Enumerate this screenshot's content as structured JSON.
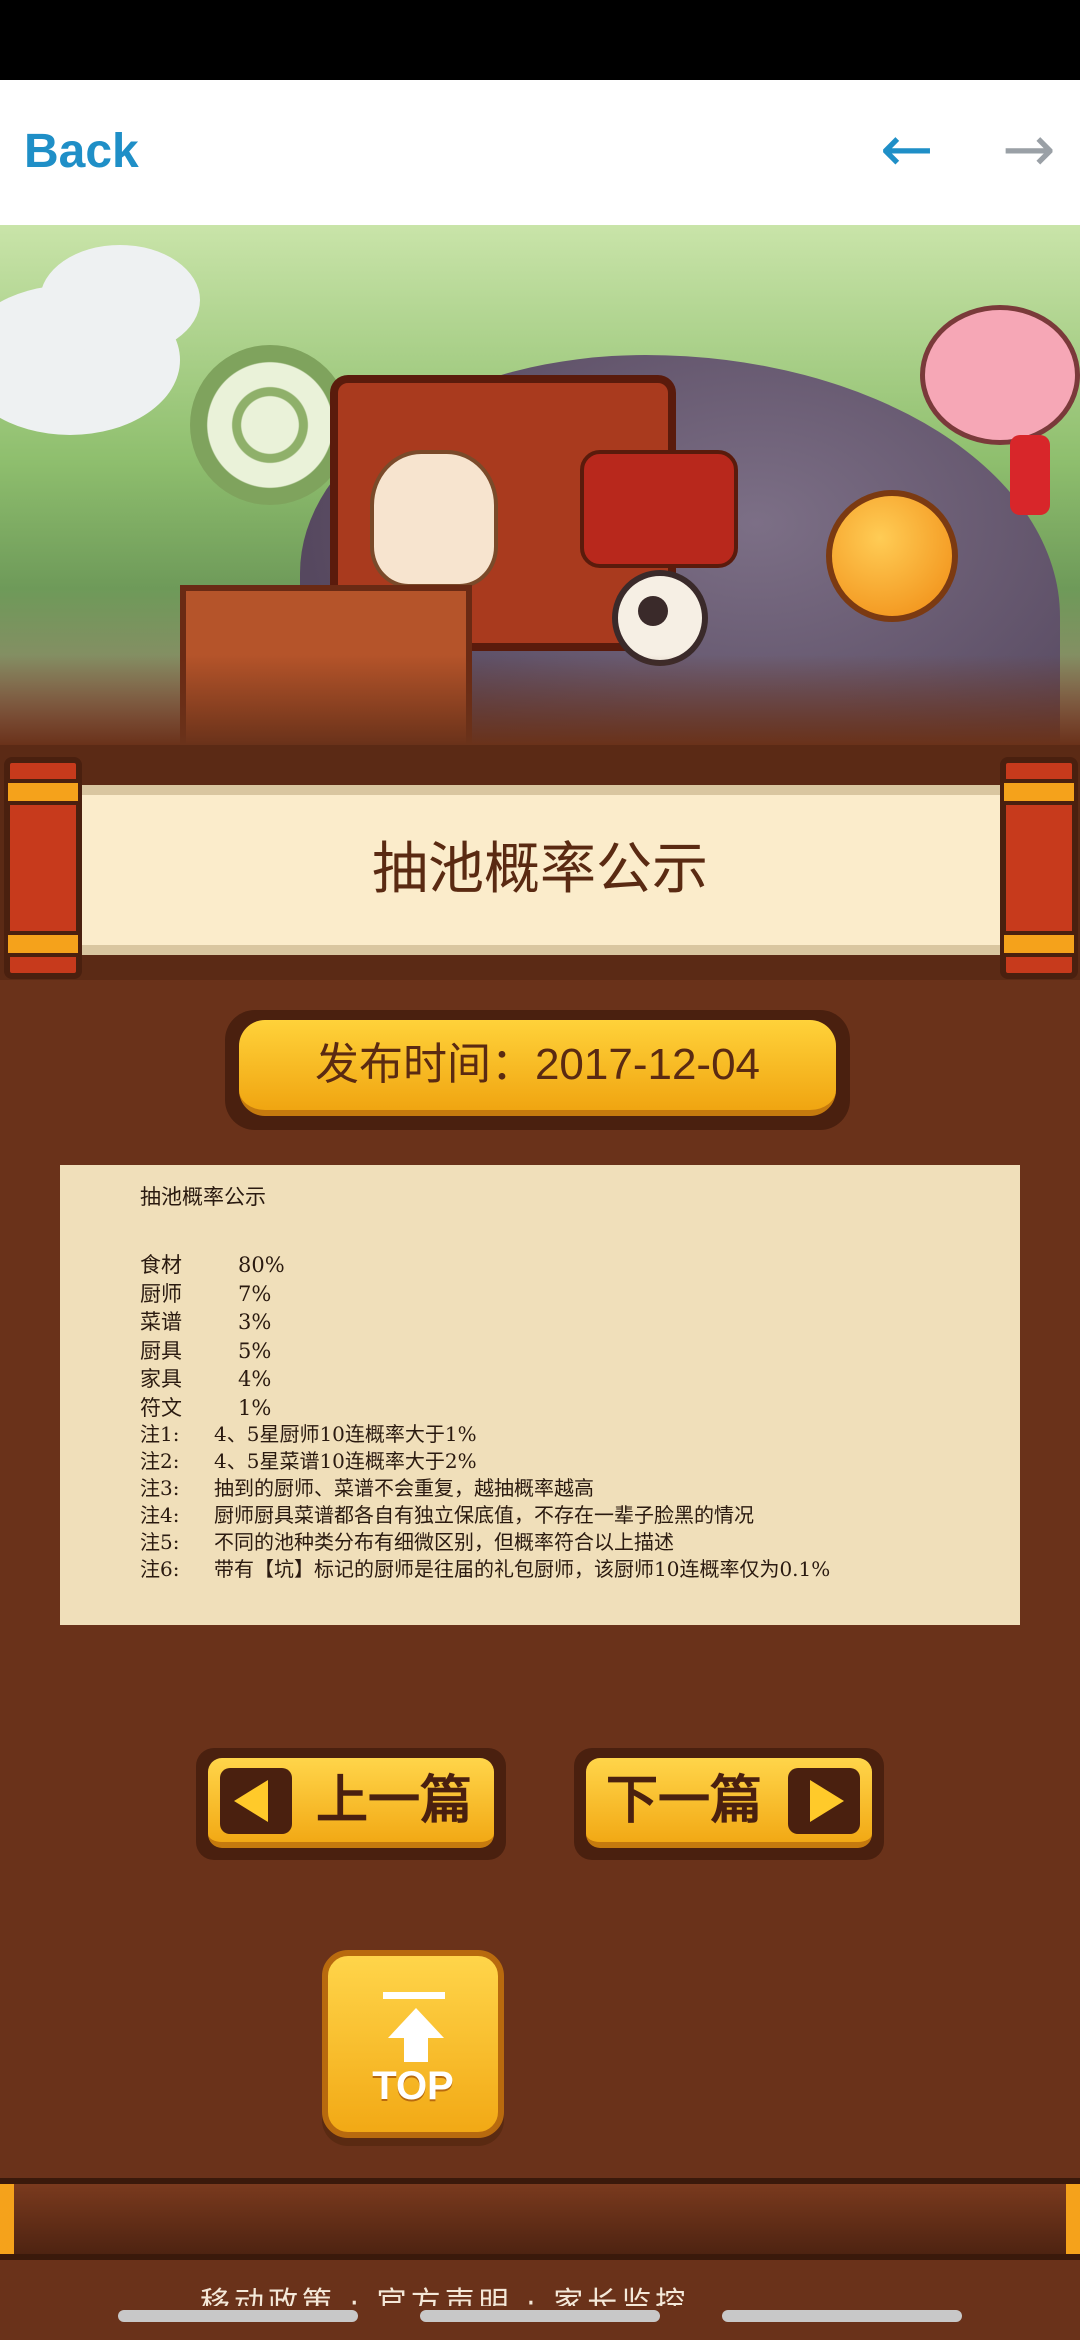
{
  "nav": {
    "back_label": "Back",
    "back_arrow": "←",
    "forward_arrow": "→"
  },
  "banner": {
    "image": "game-artwork-banner"
  },
  "article": {
    "title": "抽池概率公示",
    "publish_time": "发布时间：2017-12-04",
    "heading": "抽池概率公示",
    "rates": [
      {
        "item": "食材",
        "rate": "80%"
      },
      {
        "item": "厨师",
        "rate": "7%"
      },
      {
        "item": "菜谱",
        "rate": "3%"
      },
      {
        "item": "厨具",
        "rate": "5%"
      },
      {
        "item": "家具",
        "rate": "4%"
      },
      {
        "item": "符文",
        "rate": "1%"
      }
    ],
    "notes": [
      {
        "label": "注1:",
        "text": "4、5星厨师10连概率大于1%"
      },
      {
        "label": "注2:",
        "text": "4、5星菜谱10连概率大于2%"
      },
      {
        "label": "注3:",
        "text": "抽到的厨师、菜谱不会重复，越抽概率越高"
      },
      {
        "label": "注4:",
        "text": "厨师厨具菜谱都各自有独立保底值，不存在一辈子脸黑的情况"
      },
      {
        "label": "注5:",
        "text": "不同的池种类分布有细微区别，但概率符合以上描述"
      },
      {
        "label": "注6:",
        "text": "带有【坑】标记的厨师是往届的礼包厨师，该厨师10连概率仅为0.1%"
      }
    ]
  },
  "pager": {
    "prev_label": "上一篇",
    "next_label": "下一篇"
  },
  "top_button": {
    "label": "TOP"
  },
  "footer": {
    "partial_text": "移动政策 · 官方声明 · 家长监控"
  },
  "colors": {
    "background": "#6a321a",
    "accent_blue": "#1f8fc7",
    "button_gold": "#f2a915",
    "paper": "#f0dfba"
  }
}
